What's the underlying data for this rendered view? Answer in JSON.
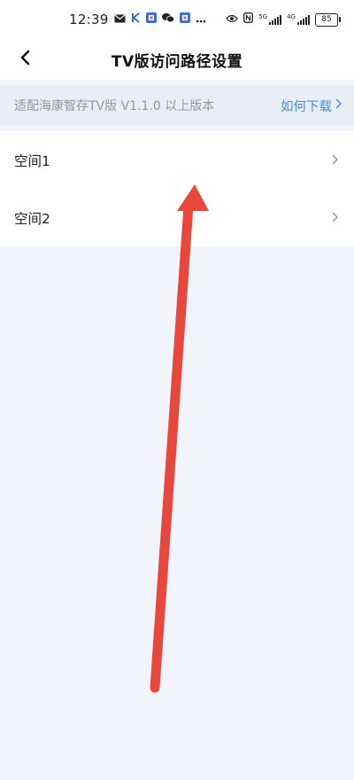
{
  "status_bar": {
    "time": "12:39",
    "net_a": "5G",
    "net_b": "4G",
    "battery": "85"
  },
  "header": {
    "title": "TV版访问路径设置"
  },
  "notice": {
    "text": "适配海康智存TV版 V1.1.0 以上版本",
    "link_label": "如何下载"
  },
  "spaces": [
    {
      "label": "空间1"
    },
    {
      "label": "空间2"
    }
  ],
  "colors": {
    "accent": "#4a8ddb",
    "annotation_arrow": "#e8483c",
    "page_background": "#f1f4fa"
  }
}
